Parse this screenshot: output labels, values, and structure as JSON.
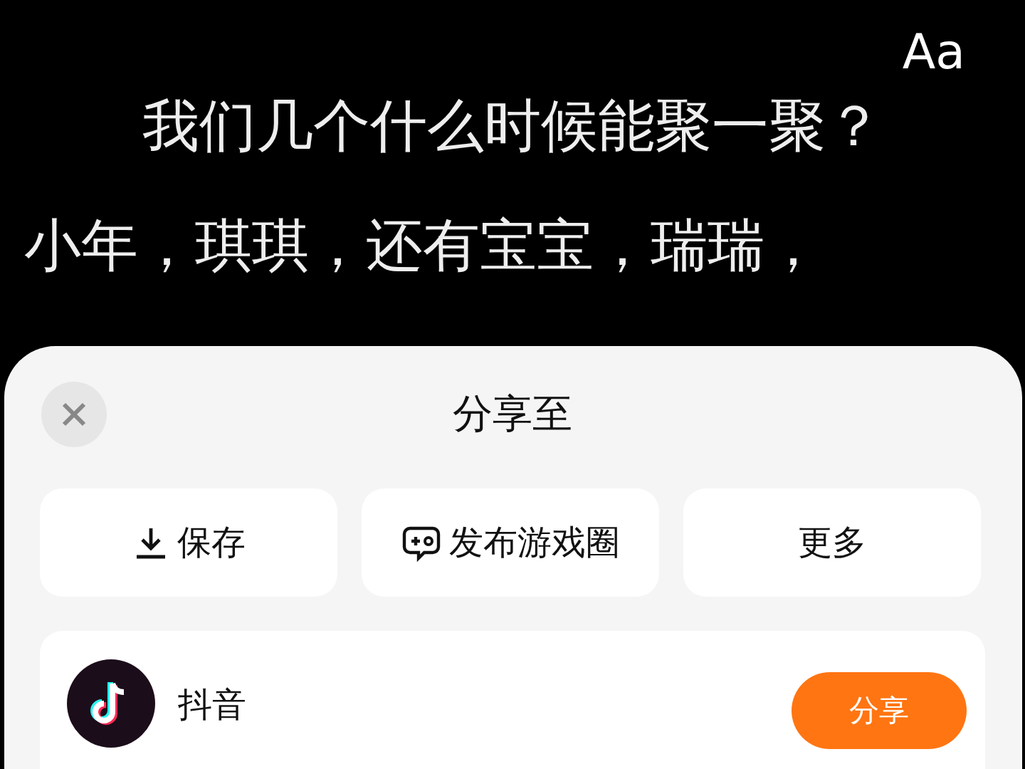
{
  "subtitles": {
    "font_button": "Aa",
    "lines": [
      "我们几个什么时候能聚一聚？",
      "小年，琪琪，还有宝宝，瑞瑞，"
    ]
  },
  "share_sheet": {
    "title": "分享至",
    "actions": [
      {
        "kind": "download",
        "label": "保存"
      },
      {
        "kind": "game",
        "label": "发布游戏圈"
      },
      {
        "kind": "plain",
        "label": "更多"
      }
    ],
    "targets": [
      {
        "name": "抖音",
        "button": "分享"
      }
    ]
  }
}
